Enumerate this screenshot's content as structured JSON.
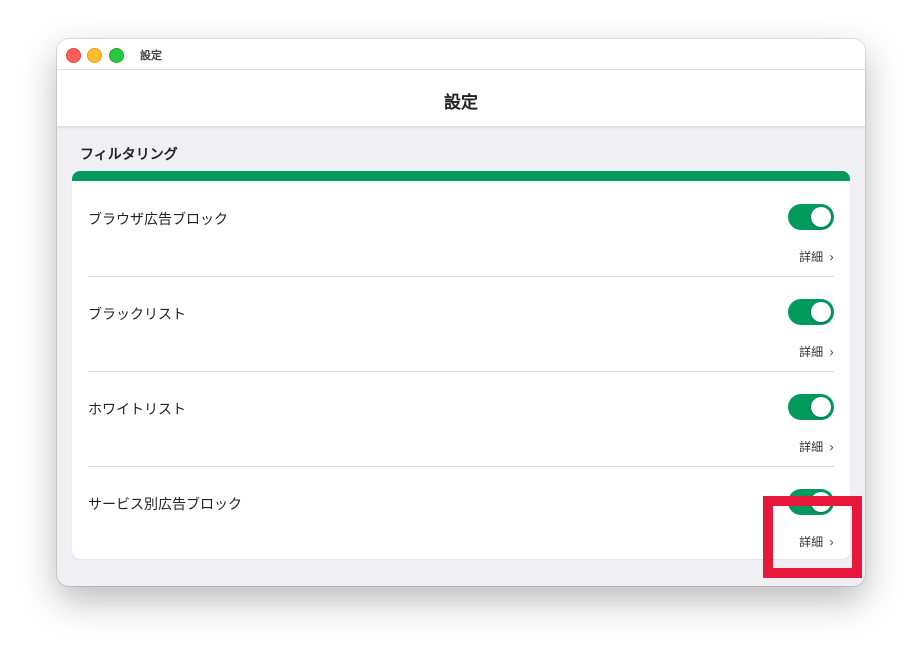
{
  "window": {
    "title": "設定"
  },
  "navbar": {
    "title": "設定"
  },
  "section": {
    "title": "フィルタリング"
  },
  "settings": [
    {
      "label": "ブラウザ広告ブロック",
      "enabled": true,
      "detail_label": "詳細"
    },
    {
      "label": "ブラックリスト",
      "enabled": true,
      "detail_label": "詳細"
    },
    {
      "label": "ホワイトリスト",
      "enabled": true,
      "detail_label": "詳細"
    },
    {
      "label": "サービス別広告ブロック",
      "enabled": true,
      "detail_label": "詳細"
    }
  ],
  "icons": {
    "detail_chevron": "›"
  },
  "colors": {
    "accent": "#009a5c",
    "toggle_on": "#009a5c",
    "highlight": "#e8173c"
  }
}
